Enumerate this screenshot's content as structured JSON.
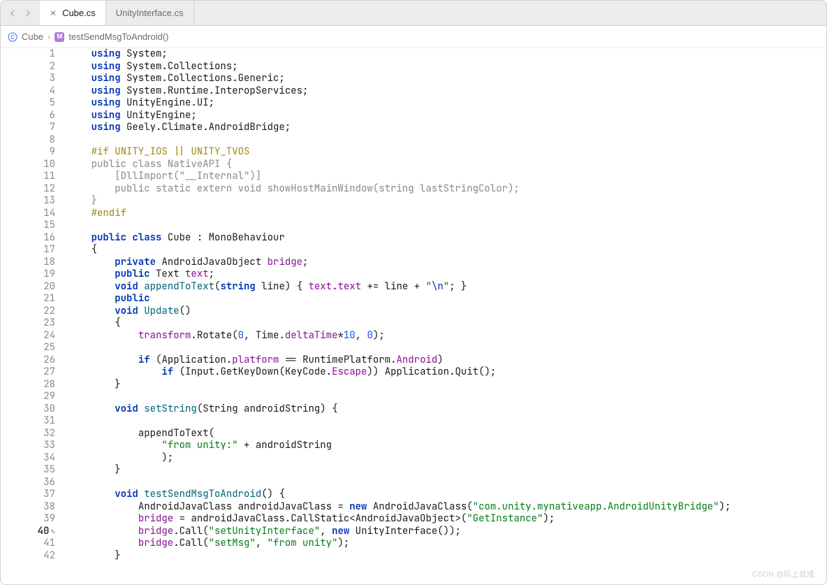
{
  "tabs": [
    {
      "label": "Cube.cs",
      "active": true
    },
    {
      "label": "UnityInterface.cs",
      "active": false
    }
  ],
  "breadcrumb": {
    "class_name": "Cube",
    "method_name": "testSendMsgToAndroid()",
    "separator": "›"
  },
  "code": {
    "lines": [
      {
        "n": 1,
        "tokens": [
          {
            "t": "kw",
            "v": "using"
          },
          {
            "t": "sp",
            "v": " "
          },
          {
            "t": "ns",
            "v": "System"
          },
          {
            "t": "punct",
            "v": ";"
          }
        ]
      },
      {
        "n": 2,
        "tokens": [
          {
            "t": "kw",
            "v": "using"
          },
          {
            "t": "sp",
            "v": " "
          },
          {
            "t": "ns",
            "v": "System.Collections"
          },
          {
            "t": "punct",
            "v": ";"
          }
        ]
      },
      {
        "n": 3,
        "tokens": [
          {
            "t": "kw",
            "v": "using"
          },
          {
            "t": "sp",
            "v": " "
          },
          {
            "t": "ns",
            "v": "System.Collections.Generic"
          },
          {
            "t": "punct",
            "v": ";"
          }
        ]
      },
      {
        "n": 4,
        "tokens": [
          {
            "t": "kw",
            "v": "using"
          },
          {
            "t": "sp",
            "v": " "
          },
          {
            "t": "ns",
            "v": "System.Runtime.InteropServices"
          },
          {
            "t": "punct",
            "v": ";"
          }
        ]
      },
      {
        "n": 5,
        "tokens": [
          {
            "t": "kw",
            "v": "using"
          },
          {
            "t": "sp",
            "v": " "
          },
          {
            "t": "ns",
            "v": "UnityEngine.UI"
          },
          {
            "t": "punct",
            "v": ";"
          }
        ]
      },
      {
        "n": 6,
        "tokens": [
          {
            "t": "kw",
            "v": "using"
          },
          {
            "t": "sp",
            "v": " "
          },
          {
            "t": "ns",
            "v": "UnityEngine"
          },
          {
            "t": "punct",
            "v": ";"
          }
        ]
      },
      {
        "n": 7,
        "tokens": [
          {
            "t": "kw",
            "v": "using"
          },
          {
            "t": "sp",
            "v": " "
          },
          {
            "t": "ns",
            "v": "Geely.Climate.AndroidBridge"
          },
          {
            "t": "punct",
            "v": ";"
          }
        ]
      },
      {
        "n": 8,
        "tokens": []
      },
      {
        "n": 9,
        "tokens": [
          {
            "t": "pp",
            "v": "#if UNITY_IOS || UNITY_TVOS"
          }
        ]
      },
      {
        "n": 10,
        "tokens": [
          {
            "t": "pp-inactive",
            "v": "public class NativeAPI {"
          }
        ]
      },
      {
        "n": 11,
        "tokens": [
          {
            "t": "pp-inactive",
            "v": "    [DllImport(\"__Internal\")]"
          }
        ]
      },
      {
        "n": 12,
        "tokens": [
          {
            "t": "pp-inactive",
            "v": "    public static extern void showHostMainWindow(string lastStringColor);"
          }
        ]
      },
      {
        "n": 13,
        "tokens": [
          {
            "t": "pp-inactive",
            "v": "}"
          }
        ]
      },
      {
        "n": 14,
        "tokens": [
          {
            "t": "pp",
            "v": "#endif"
          }
        ]
      },
      {
        "n": 15,
        "tokens": []
      },
      {
        "n": 16,
        "tokens": [
          {
            "t": "kw",
            "v": "public"
          },
          {
            "t": "sp",
            "v": " "
          },
          {
            "t": "kw",
            "v": "class"
          },
          {
            "t": "sp",
            "v": " "
          },
          {
            "t": "cls",
            "v": "Cube"
          },
          {
            "t": "sp",
            "v": " "
          },
          {
            "t": "punct",
            "v": ":"
          },
          {
            "t": "sp",
            "v": " "
          },
          {
            "t": "type",
            "v": "MonoBehaviour"
          }
        ]
      },
      {
        "n": 17,
        "tokens": [
          {
            "t": "punct",
            "v": "{"
          }
        ]
      },
      {
        "n": 18,
        "indent": 1,
        "tokens": [
          {
            "t": "kw",
            "v": "private"
          },
          {
            "t": "sp",
            "v": " "
          },
          {
            "t": "type",
            "v": "AndroidJavaObject"
          },
          {
            "t": "sp",
            "v": " "
          },
          {
            "t": "field",
            "v": "bridge"
          },
          {
            "t": "punct",
            "v": ";"
          }
        ]
      },
      {
        "n": 19,
        "indent": 1,
        "tokens": [
          {
            "t": "kw",
            "v": "public"
          },
          {
            "t": "sp",
            "v": " "
          },
          {
            "t": "type",
            "v": "Text"
          },
          {
            "t": "sp",
            "v": " "
          },
          {
            "t": "field",
            "v": "text"
          },
          {
            "t": "punct",
            "v": ";"
          }
        ]
      },
      {
        "n": 20,
        "indent": 1,
        "tokens": [
          {
            "t": "kw",
            "v": "void"
          },
          {
            "t": "sp",
            "v": " "
          },
          {
            "t": "method-def",
            "v": "appendToText"
          },
          {
            "t": "punct",
            "v": "("
          },
          {
            "t": "kw",
            "v": "string"
          },
          {
            "t": "sp",
            "v": " "
          },
          {
            "t": "param",
            "v": "line"
          },
          {
            "t": "punct",
            "v": ")"
          },
          {
            "t": "sp",
            "v": " "
          },
          {
            "t": "punct",
            "v": "{"
          },
          {
            "t": "sp",
            "v": " "
          },
          {
            "t": "field",
            "v": "text"
          },
          {
            "t": "punct",
            "v": "."
          },
          {
            "t": "field",
            "v": "text"
          },
          {
            "t": "sp",
            "v": " "
          },
          {
            "t": "punct",
            "v": "+="
          },
          {
            "t": "sp",
            "v": " "
          },
          {
            "t": "param",
            "v": "line"
          },
          {
            "t": "sp",
            "v": " "
          },
          {
            "t": "punct",
            "v": "+"
          },
          {
            "t": "sp",
            "v": " "
          },
          {
            "t": "str",
            "v": "\""
          },
          {
            "t": "str-esc",
            "v": "\\n"
          },
          {
            "t": "str",
            "v": "\""
          },
          {
            "t": "punct",
            "v": ";"
          },
          {
            "t": "sp",
            "v": " "
          },
          {
            "t": "punct",
            "v": "}"
          }
        ]
      },
      {
        "n": 21,
        "indent": 1,
        "tokens": [
          {
            "t": "kw",
            "v": "public"
          }
        ]
      },
      {
        "n": 22,
        "indent": 1,
        "tokens": [
          {
            "t": "kw",
            "v": "void"
          },
          {
            "t": "sp",
            "v": " "
          },
          {
            "t": "method-def",
            "v": "Update"
          },
          {
            "t": "punct",
            "v": "()"
          }
        ]
      },
      {
        "n": 23,
        "indent": 1,
        "tokens": [
          {
            "t": "punct",
            "v": "{"
          }
        ]
      },
      {
        "n": 24,
        "indent": 2,
        "tokens": [
          {
            "t": "field",
            "v": "transform"
          },
          {
            "t": "punct",
            "v": "."
          },
          {
            "t": "method-call",
            "v": "Rotate"
          },
          {
            "t": "punct",
            "v": "("
          },
          {
            "t": "num",
            "v": "0"
          },
          {
            "t": "punct",
            "v": ","
          },
          {
            "t": "sp",
            "v": " "
          },
          {
            "t": "type",
            "v": "Time"
          },
          {
            "t": "punct",
            "v": "."
          },
          {
            "t": "field",
            "v": "deltaTime"
          },
          {
            "t": "punct",
            "v": "*"
          },
          {
            "t": "num",
            "v": "10"
          },
          {
            "t": "punct",
            "v": ","
          },
          {
            "t": "sp",
            "v": " "
          },
          {
            "t": "num",
            "v": "0"
          },
          {
            "t": "punct",
            "v": ");"
          }
        ]
      },
      {
        "n": 25,
        "tokens": []
      },
      {
        "n": 26,
        "indent": 2,
        "tokens": [
          {
            "t": "kw",
            "v": "if"
          },
          {
            "t": "sp",
            "v": " "
          },
          {
            "t": "punct",
            "v": "("
          },
          {
            "t": "type",
            "v": "Application"
          },
          {
            "t": "punct",
            "v": "."
          },
          {
            "t": "field",
            "v": "platform"
          },
          {
            "t": "sp",
            "v": " "
          },
          {
            "t": "punct",
            "v": "=="
          },
          {
            "t": "sp",
            "v": " "
          },
          {
            "t": "type",
            "v": "RuntimePlatform"
          },
          {
            "t": "punct",
            "v": "."
          },
          {
            "t": "field",
            "v": "Android"
          },
          {
            "t": "punct",
            "v": ")"
          }
        ]
      },
      {
        "n": 27,
        "indent": 3,
        "tokens": [
          {
            "t": "kw",
            "v": "if"
          },
          {
            "t": "sp",
            "v": " "
          },
          {
            "t": "punct",
            "v": "("
          },
          {
            "t": "type",
            "v": "Input"
          },
          {
            "t": "punct",
            "v": "."
          },
          {
            "t": "method-call",
            "v": "GetKeyDown"
          },
          {
            "t": "punct",
            "v": "("
          },
          {
            "t": "type",
            "v": "KeyCode"
          },
          {
            "t": "punct",
            "v": "."
          },
          {
            "t": "field",
            "v": "Escape"
          },
          {
            "t": "punct",
            "v": "))"
          },
          {
            "t": "sp",
            "v": " "
          },
          {
            "t": "type",
            "v": "Application"
          },
          {
            "t": "punct",
            "v": "."
          },
          {
            "t": "method-call",
            "v": "Quit"
          },
          {
            "t": "punct",
            "v": "();"
          }
        ]
      },
      {
        "n": 28,
        "indent": 1,
        "tokens": [
          {
            "t": "punct",
            "v": "}"
          }
        ]
      },
      {
        "n": 29,
        "tokens": []
      },
      {
        "n": 30,
        "indent": 1,
        "tokens": [
          {
            "t": "kw",
            "v": "void"
          },
          {
            "t": "sp",
            "v": " "
          },
          {
            "t": "method-def",
            "v": "setString"
          },
          {
            "t": "punct",
            "v": "("
          },
          {
            "t": "type",
            "v": "String"
          },
          {
            "t": "sp",
            "v": " "
          },
          {
            "t": "param",
            "v": "androidString"
          },
          {
            "t": "punct",
            "v": ")"
          },
          {
            "t": "sp",
            "v": " "
          },
          {
            "t": "punct",
            "v": "{"
          }
        ]
      },
      {
        "n": 31,
        "tokens": []
      },
      {
        "n": 32,
        "indent": 2,
        "tokens": [
          {
            "t": "method-call",
            "v": "appendToText"
          },
          {
            "t": "punct",
            "v": "("
          }
        ]
      },
      {
        "n": 33,
        "indent": 3,
        "tokens": [
          {
            "t": "str",
            "v": "\"from unity:\""
          },
          {
            "t": "sp",
            "v": " "
          },
          {
            "t": "punct",
            "v": "+"
          },
          {
            "t": "sp",
            "v": " "
          },
          {
            "t": "param",
            "v": "androidString"
          }
        ]
      },
      {
        "n": 34,
        "indent": 3,
        "tokens": [
          {
            "t": "punct",
            "v": ");"
          }
        ]
      },
      {
        "n": 35,
        "indent": 1,
        "tokens": [
          {
            "t": "punct",
            "v": "}"
          }
        ]
      },
      {
        "n": 36,
        "tokens": []
      },
      {
        "n": 37,
        "indent": 1,
        "tokens": [
          {
            "t": "kw",
            "v": "void"
          },
          {
            "t": "sp",
            "v": " "
          },
          {
            "t": "method-def",
            "v": "testSendMsgToAndroid"
          },
          {
            "t": "punct",
            "v": "()"
          },
          {
            "t": "sp",
            "v": " "
          },
          {
            "t": "punct",
            "v": "{"
          }
        ]
      },
      {
        "n": 38,
        "indent": 2,
        "tokens": [
          {
            "t": "type",
            "v": "AndroidJavaClass"
          },
          {
            "t": "sp",
            "v": " "
          },
          {
            "t": "param",
            "v": "androidJavaClass"
          },
          {
            "t": "sp",
            "v": " "
          },
          {
            "t": "punct",
            "v": "="
          },
          {
            "t": "sp",
            "v": " "
          },
          {
            "t": "kw",
            "v": "new"
          },
          {
            "t": "sp",
            "v": " "
          },
          {
            "t": "type",
            "v": "AndroidJavaClass"
          },
          {
            "t": "punct",
            "v": "("
          },
          {
            "t": "str",
            "v": "\"com.unity.mynativeapp.AndroidUnityBridge\""
          },
          {
            "t": "punct",
            "v": ");"
          }
        ]
      },
      {
        "n": 39,
        "indent": 2,
        "tokens": [
          {
            "t": "field",
            "v": "bridge"
          },
          {
            "t": "sp",
            "v": " "
          },
          {
            "t": "punct",
            "v": "="
          },
          {
            "t": "sp",
            "v": " "
          },
          {
            "t": "param",
            "v": "androidJavaClass"
          },
          {
            "t": "punct",
            "v": "."
          },
          {
            "t": "method-call",
            "v": "CallStatic"
          },
          {
            "t": "punct",
            "v": "<"
          },
          {
            "t": "type",
            "v": "AndroidJavaObject"
          },
          {
            "t": "punct",
            "v": ">("
          },
          {
            "t": "str",
            "v": "\"GetInstance\""
          },
          {
            "t": "punct",
            "v": ");"
          }
        ]
      },
      {
        "n": 40,
        "indent": 2,
        "current": true,
        "bookmark": true,
        "tokens": [
          {
            "t": "field",
            "v": "bridge"
          },
          {
            "t": "punct",
            "v": "."
          },
          {
            "t": "method-call",
            "v": "Call"
          },
          {
            "t": "punct",
            "v": "("
          },
          {
            "t": "str",
            "v": "\"setUnityInterface\""
          },
          {
            "t": "punct",
            "v": ","
          },
          {
            "t": "sp",
            "v": " "
          },
          {
            "t": "kw",
            "v": "new"
          },
          {
            "t": "sp",
            "v": " "
          },
          {
            "t": "type",
            "v": "UnityInterface"
          },
          {
            "t": "punct",
            "v": "());"
          }
        ]
      },
      {
        "n": 41,
        "indent": 2,
        "tokens": [
          {
            "t": "field",
            "v": "bridge"
          },
          {
            "t": "punct",
            "v": "."
          },
          {
            "t": "method-call",
            "v": "Call"
          },
          {
            "t": "punct",
            "v": "("
          },
          {
            "t": "str",
            "v": "\"setMsg\""
          },
          {
            "t": "punct",
            "v": ","
          },
          {
            "t": "sp",
            "v": " "
          },
          {
            "t": "str",
            "v": "\"from unity\""
          },
          {
            "t": "punct",
            "v": ");"
          }
        ]
      },
      {
        "n": 42,
        "indent": 1,
        "tokens": [
          {
            "t": "punct",
            "v": "}"
          }
        ]
      }
    ],
    "base_indent": "    ",
    "level_indent": "    "
  },
  "watermark": "CSDN @码上就成"
}
